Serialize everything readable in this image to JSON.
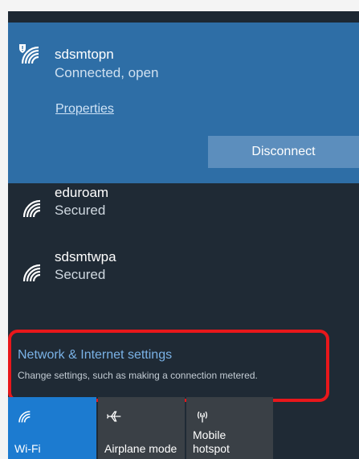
{
  "connected": {
    "ssid": "sdsmtopn",
    "status": "Connected, open",
    "properties_label": "Properties",
    "disconnect_label": "Disconnect"
  },
  "networks": [
    {
      "ssid": "eduroam",
      "status": "Secured"
    },
    {
      "ssid": "sdsmtwpa",
      "status": "Secured"
    }
  ],
  "settings": {
    "title": "Network & Internet settings",
    "subtitle": "Change settings, such as making a connection metered."
  },
  "quick_actions": [
    {
      "label": "Wi-Fi",
      "icon": "wifi-icon",
      "active": true
    },
    {
      "label": "Airplane mode",
      "icon": "airplane-icon",
      "active": false
    },
    {
      "label": "Mobile\nhotspot",
      "icon": "hotspot-icon",
      "active": false
    }
  ],
  "colors": {
    "accent": "#2e6ea6",
    "button": "#5c8ebd",
    "panel": "#1f2a35",
    "link": "#7ab2e6",
    "highlight": "#e8171b",
    "wifi_tile": "#1c7bd0"
  }
}
